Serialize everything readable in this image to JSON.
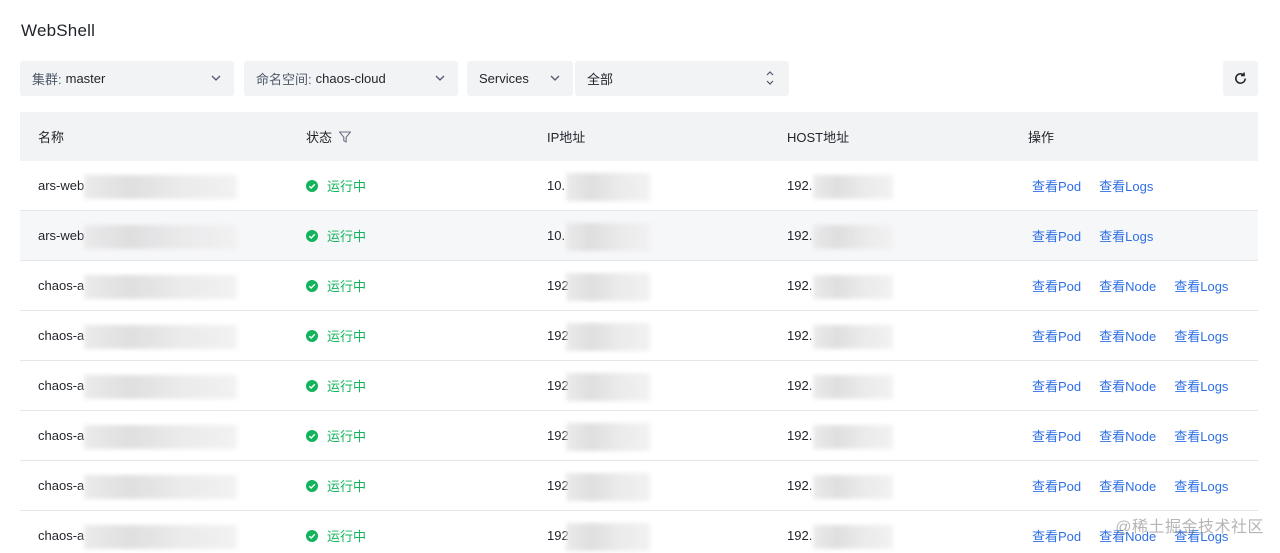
{
  "page": {
    "title": "WebShell"
  },
  "filters": {
    "cluster": {
      "label": "集群:",
      "value": "master"
    },
    "namespace": {
      "label": "命名空间:",
      "value": "chaos-cloud"
    },
    "resource_type": {
      "value": "Services"
    },
    "scope": {
      "value": "全部"
    }
  },
  "table": {
    "columns": [
      "名称",
      "状态",
      "IP地址",
      "HOST地址",
      "操作"
    ],
    "rows": [
      {
        "name": "ars-web",
        "status": "运行中",
        "ip": "10.",
        "host": "192.",
        "ops": [
          "查看Pod",
          "查看Logs"
        ]
      },
      {
        "name": "ars-web",
        "status": "运行中",
        "ip": "10.",
        "host": "192.",
        "ops": [
          "查看Pod",
          "查看Logs"
        ]
      },
      {
        "name": "chaos-a",
        "status": "运行中",
        "ip": "192",
        "host": "192.",
        "ops": [
          "查看Pod",
          "查看Node",
          "查看Logs"
        ]
      },
      {
        "name": "chaos-a",
        "status": "运行中",
        "ip": "192",
        "host": "192.",
        "ops": [
          "查看Pod",
          "查看Node",
          "查看Logs"
        ]
      },
      {
        "name": "chaos-a",
        "status": "运行中",
        "ip": "192",
        "host": "192.",
        "ops": [
          "查看Pod",
          "查看Node",
          "查看Logs"
        ]
      },
      {
        "name": "chaos-a",
        "status": "运行中",
        "ip": "192",
        "host": "192.",
        "ops": [
          "查看Pod",
          "查看Node",
          "查看Logs"
        ]
      },
      {
        "name": "chaos-a",
        "status": "运行中",
        "ip": "192",
        "host": "192.",
        "ops": [
          "查看Pod",
          "查看Node",
          "查看Logs"
        ]
      },
      {
        "name": "chaos-a",
        "status": "运行中",
        "ip": "192",
        "host": "192.",
        "ops": [
          "查看Pod",
          "查看Node",
          "查看Logs"
        ]
      }
    ]
  },
  "watermark": "@稀土掘金技术社区",
  "colors": {
    "running": "#12b35d",
    "link": "#2f6fe4",
    "header_bg": "#f2f3f5"
  },
  "icons": {
    "refresh": "refresh-icon",
    "filter": "filter-icon",
    "status": "check-circle-icon"
  }
}
